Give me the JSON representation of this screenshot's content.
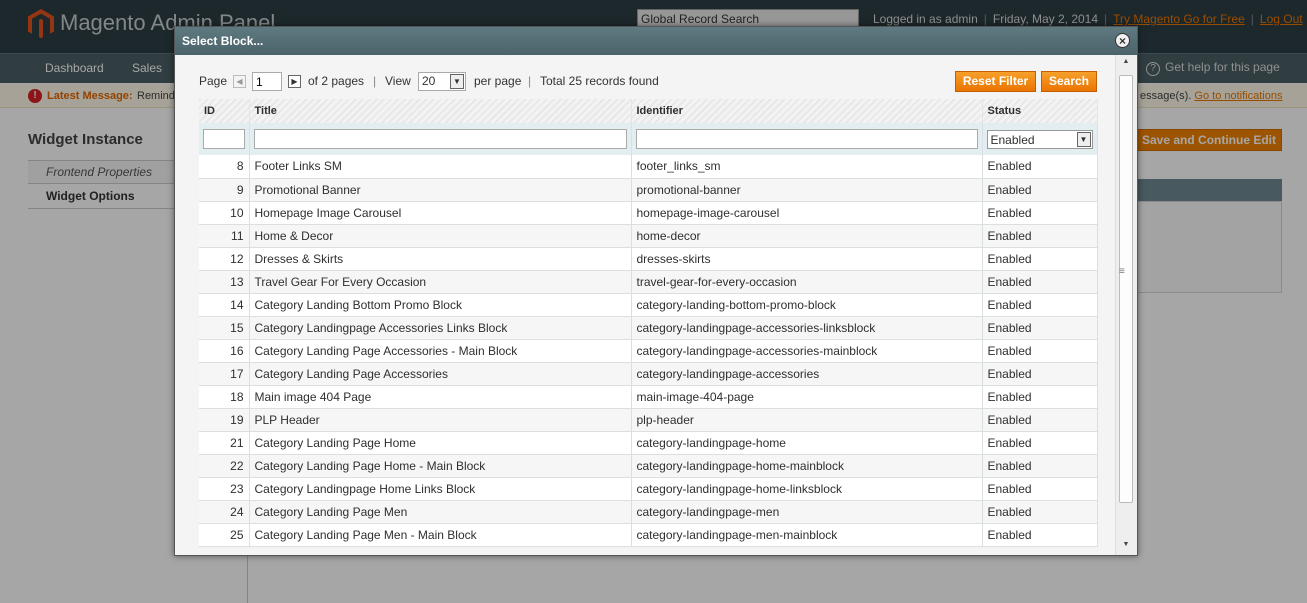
{
  "header": {
    "logo_text": "Magento Admin Panel",
    "search_placeholder": "Global Record Search",
    "logged_in": "Logged in as admin",
    "date": "Friday, May 2, 2014",
    "try_link": "Try Magento Go for Free",
    "logout": "Log Out"
  },
  "nav": {
    "items": [
      "Dashboard",
      "Sales"
    ],
    "help": "Get help for this page"
  },
  "message": {
    "label": "Latest Message:",
    "text": "Remind",
    "right_text": "essage(s).",
    "link": "Go to notifications"
  },
  "sidebar": {
    "title": "Widget Instance",
    "tabs": [
      "Frontend Properties",
      "Widget Options"
    ]
  },
  "buttons": {
    "save_continue": "Save and Continue Edit"
  },
  "modal": {
    "title": "Select Block...",
    "pager": {
      "page_label": "Page",
      "page_value": "1",
      "of_pages": "of 2 pages",
      "view_label": "View",
      "per_page_value": "20",
      "per_page_label": "per page",
      "total": "Total 25 records found"
    },
    "reset_filter": "Reset Filter",
    "search": "Search",
    "columns": [
      "ID",
      "Title",
      "Identifier",
      "Status"
    ],
    "status_filter": "Enabled",
    "rows": [
      {
        "id": "8",
        "title": "Footer Links SM",
        "identifier": "footer_links_sm",
        "status": "Enabled"
      },
      {
        "id": "9",
        "title": "Promotional Banner",
        "identifier": "promotional-banner",
        "status": "Enabled"
      },
      {
        "id": "10",
        "title": "Homepage Image Carousel",
        "identifier": "homepage-image-carousel",
        "status": "Enabled"
      },
      {
        "id": "11",
        "title": "Home & Decor",
        "identifier": "home-decor",
        "status": "Enabled"
      },
      {
        "id": "12",
        "title": "Dresses & Skirts",
        "identifier": "dresses-skirts",
        "status": "Enabled"
      },
      {
        "id": "13",
        "title": "Travel Gear For Every Occasion",
        "identifier": "travel-gear-for-every-occasion",
        "status": "Enabled"
      },
      {
        "id": "14",
        "title": "Category Landing Bottom Promo Block",
        "identifier": "category-landing-bottom-promo-block",
        "status": "Enabled"
      },
      {
        "id": "15",
        "title": "Category Landingpage Accessories Links Block",
        "identifier": "category-landingpage-accessories-linksblock",
        "status": "Enabled"
      },
      {
        "id": "16",
        "title": "Category Landing Page Accessories - Main Block",
        "identifier": "category-landingpage-accessories-mainblock",
        "status": "Enabled"
      },
      {
        "id": "17",
        "title": "Category Landing Page Accessories",
        "identifier": "category-landingpage-accessories",
        "status": "Enabled"
      },
      {
        "id": "18",
        "title": "Main image 404 Page",
        "identifier": "main-image-404-page",
        "status": "Enabled"
      },
      {
        "id": "19",
        "title": "PLP Header",
        "identifier": "plp-header",
        "status": "Enabled"
      },
      {
        "id": "21",
        "title": "Category Landing Page Home",
        "identifier": "category-landingpage-home",
        "status": "Enabled"
      },
      {
        "id": "22",
        "title": "Category Landing Page Home - Main Block",
        "identifier": "category-landingpage-home-mainblock",
        "status": "Enabled"
      },
      {
        "id": "23",
        "title": "Category Landingpage Home Links Block",
        "identifier": "category-landingpage-home-linksblock",
        "status": "Enabled"
      },
      {
        "id": "24",
        "title": "Category Landing Page Men",
        "identifier": "category-landingpage-men",
        "status": "Enabled"
      },
      {
        "id": "25",
        "title": "Category Landing Page Men - Main Block",
        "identifier": "category-landingpage-men-mainblock",
        "status": "Enabled"
      }
    ]
  },
  "colors": {
    "accent": "#eb7400",
    "header_bg": "#2d3e44",
    "modal_head": "#4b6269"
  }
}
